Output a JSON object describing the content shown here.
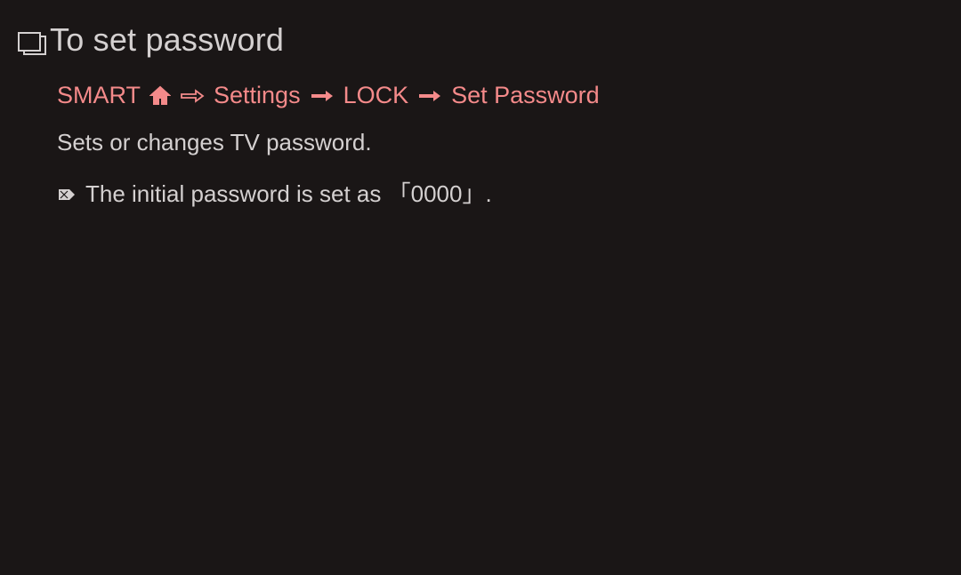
{
  "title": "To set password",
  "breadcrumb": {
    "smart": "SMART",
    "settings": "Settings",
    "lock": "LOCK",
    "set_password": "Set Password"
  },
  "description": "Sets or changes TV password.",
  "note": {
    "prefix": "The initial password is set as ",
    "bracket_open": "「",
    "value": "0000",
    "bracket_close": "」",
    "suffix": "."
  }
}
